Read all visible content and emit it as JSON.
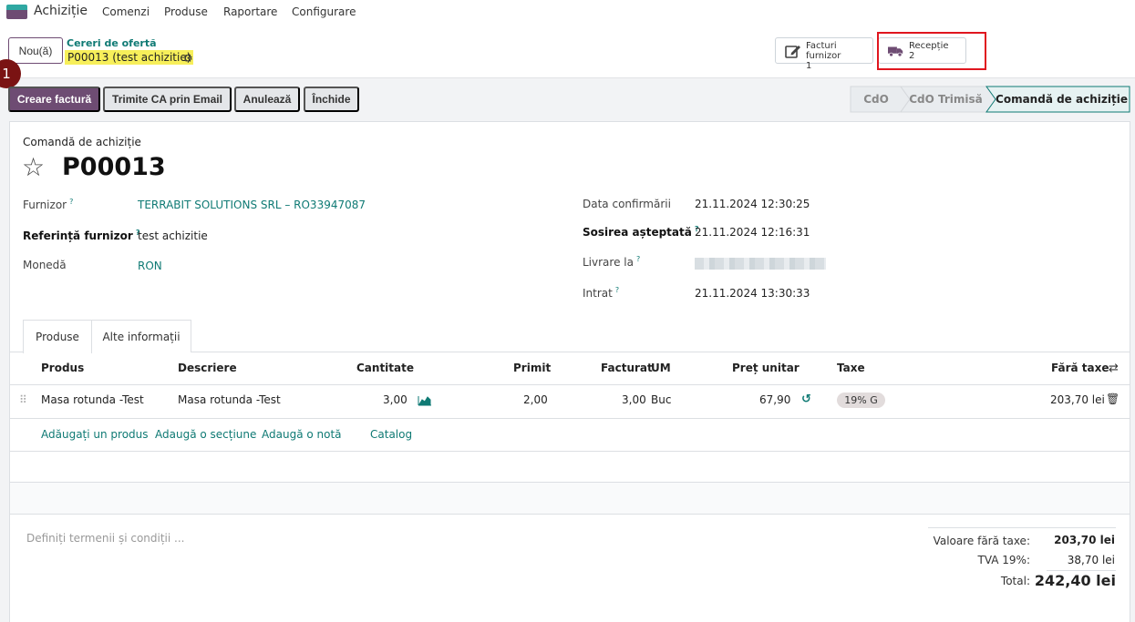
{
  "nav": {
    "brand": "Achiziție",
    "menu": [
      "Comenzi",
      "Produse",
      "Raportare",
      "Configurare"
    ]
  },
  "control": {
    "new_label": "Nou(ă)",
    "breadcrumb_parent": "Cereri de ofertă",
    "breadcrumb_current": "P00013 (test achizitie)",
    "step_badge": "1",
    "smart_buttons": [
      {
        "title": "Facturi furnizor",
        "count": "1"
      },
      {
        "title": "Recepție",
        "count": "2"
      }
    ]
  },
  "actions": [
    "Creare factură",
    "Trimite CA prin Email",
    "Anulează",
    "Închide"
  ],
  "stages": [
    {
      "label": "CdO",
      "active": false
    },
    {
      "label": "CdO Trimisă",
      "active": false
    },
    {
      "label": "Comandă de achiziție",
      "active": true
    }
  ],
  "form": {
    "doc_type": "Comandă de achiziție",
    "name": "P00013",
    "left_fields": [
      {
        "label": "Furnizor",
        "help": "?",
        "value": "TERRABIT SOLUTIONS SRL – RO33947087"
      },
      {
        "label": "Referință furnizor",
        "help": "?",
        "value": "test achizitie"
      },
      {
        "label": "Monedă",
        "help": "",
        "value": "RON"
      }
    ],
    "right_fields": [
      {
        "label": "Data confirmării",
        "help": "",
        "value": "21.11.2024 12:30:25"
      },
      {
        "label": "Sosirea așteptată",
        "help": "?",
        "value": "21.11.2024 12:16:31"
      },
      {
        "label": "Livrare la",
        "help": "?",
        "value": ""
      },
      {
        "label": "Intrat",
        "help": "?",
        "value": "21.11.2024 13:30:33"
      }
    ]
  },
  "tabs": [
    "Produse",
    "Alte informații"
  ],
  "table": {
    "headers": [
      "Produs",
      "Descriere",
      "Cantitate",
      "Primit",
      "Facturat",
      "UM",
      "Preț unitar",
      "Taxe",
      "Fără taxe"
    ],
    "rows": [
      {
        "product": "Masa rotunda -Test",
        "description": "Masa rotunda -Test",
        "qty": "3,00",
        "received": "2,00",
        "invoiced": "3,00",
        "uom": "Buc",
        "price": "67,90",
        "tax": "19% G",
        "subtotal": "203,70 lei"
      }
    ],
    "add_links": [
      "Adăugați un produs",
      "Adaugă o secțiune",
      "Adaugă o notă",
      "Catalog"
    ]
  },
  "terms_placeholder": "Definiți termenii și condiții ...",
  "totals": {
    "untaxed_label": "Valoare fără taxe:",
    "untaxed": "203,70 lei",
    "tax_label": "TVA 19%:",
    "tax": "38,70 lei",
    "total_label": "Total:",
    "total": "242,40 lei"
  },
  "colors": {
    "primary": "#6e4c73",
    "link": "#0f7a74",
    "highlight": "#f7ef5a",
    "annotation_red": "#e0161f"
  }
}
